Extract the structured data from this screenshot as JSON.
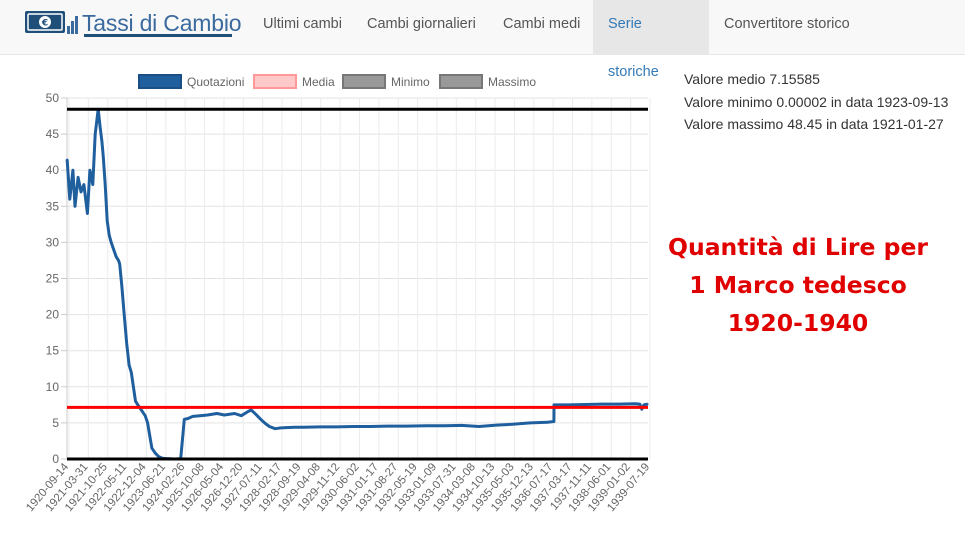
{
  "nav": {
    "brand": "Tassi di Cambio",
    "items": [
      {
        "label": "Ultimi cambi",
        "active": false
      },
      {
        "label": "Cambi giornalieri",
        "active": false
      },
      {
        "label": "Cambi medi",
        "active": false
      },
      {
        "label": "Serie storiche",
        "active": true
      },
      {
        "label": "Convertitore storico",
        "active": false
      }
    ]
  },
  "stats": {
    "avg": "Valore medio 7.15585",
    "min": "Valore minimo 0.00002 in data 1923-09-13",
    "max": "Valore massimo 48.45 in data 1921-01-27"
  },
  "caption": {
    "line1": "Quantità di Lire per",
    "line2": "1 Marco tedesco",
    "line3": "1920-1940"
  },
  "colors": {
    "series": "#1f5f9e",
    "mean": "#ff0000",
    "extreme": "#000000",
    "accent": "#337ab7"
  },
  "chart_data": {
    "type": "line",
    "title": "",
    "xlabel": "",
    "ylabel": "",
    "ylim": [
      0,
      50
    ],
    "yticks": [
      0,
      5,
      10,
      15,
      20,
      25,
      30,
      35,
      40,
      45,
      50
    ],
    "grid": true,
    "legend_position": "top",
    "legend": [
      {
        "name": "Quotazioni",
        "fill": "#1f5f9e",
        "stroke": "#1a4e85"
      },
      {
        "name": "Media",
        "fill": "#ffc9c9",
        "stroke": "#ff9999"
      },
      {
        "name": "Minimo",
        "fill": "#999999",
        "stroke": "#777777"
      },
      {
        "name": "Massimo",
        "fill": "#999999",
        "stroke": "#777777"
      }
    ],
    "x_labels": [
      "1920-09-14",
      "1921-03-31",
      "1921-10-25",
      "1922-05-11",
      "1922-12-04",
      "1923-06-21",
      "1924-02-26",
      "1925-10-08",
      "1926-05-04",
      "1926-12-20",
      "1927-07-11",
      "1928-02-17",
      "1928-09-19",
      "1929-04-08",
      "1929-11-12",
      "1930-06-02",
      "1931-01-17",
      "1931-08-27",
      "1932-05-19",
      "1933-01-09",
      "1933-07-31",
      "1934-03-08",
      "1934-10-13",
      "1935-05-03",
      "1935-12-13",
      "1936-07-17",
      "1937-03-17",
      "1937-11-11",
      "1938-06-01",
      "1939-01-02",
      "1939-07-19"
    ],
    "series": [
      {
        "name": "Quotazioni",
        "x": [
          "1920-01-02",
          "1920-02-05",
          "1920-03-15",
          "1920-04-10",
          "1920-05-20",
          "1920-06-25",
          "1920-08-01",
          "1920-09-14",
          "1920-10-15",
          "1920-11-20",
          "1920-12-20",
          "1921-01-27",
          "1921-02-20",
          "1921-03-15",
          "1921-03-31",
          "1921-04-25",
          "1921-05-20",
          "1921-06-15",
          "1921-07-10",
          "1921-08-10",
          "1921-09-10",
          "1921-10-10",
          "1921-10-25",
          "1921-11-20",
          "1921-12-20",
          "1922-01-20",
          "1922-02-20",
          "1922-03-20",
          "1922-04-15",
          "1922-05-11",
          "1922-06-10",
          "1922-07-10",
          "1922-08-10",
          "1922-09-10",
          "1922-10-10",
          "1922-11-10",
          "1922-12-04",
          "1923-01-15",
          "1923-03-01",
          "1923-04-15",
          "1923-06-01",
          "1923-06-21",
          "1923-09-13",
          "1923-12-01",
          "1924-01-15",
          "1924-02-26",
          "1924-05-01",
          "1924-08-01",
          "1924-11-01",
          "1925-03-01",
          "1925-06-01",
          "1925-10-08",
          "1926-01-01",
          "1926-03-15",
          "1926-05-04",
          "1926-07-01",
          "1926-09-01",
          "1926-10-20",
          "1926-12-20",
          "1927-03-01",
          "1927-05-01",
          "1927-07-11",
          "1927-11-01",
          "1928-02-17",
          "1928-09-19",
          "1929-04-08",
          "1929-11-12",
          "1930-06-02",
          "1931-01-17",
          "1931-08-27",
          "1932-05-19",
          "1933-01-09",
          "1933-07-31",
          "1934-03-08",
          "1934-10-13",
          "1935-05-03",
          "1935-12-13",
          "1936-07-17",
          "1936-10-05",
          "1936-10-06",
          "1937-03-17",
          "1937-11-11",
          "1938-06-01",
          "1939-01-02",
          "1939-07-19",
          "1939-09-20",
          "1939-10-15",
          "1939-11-10",
          "1939-12-29"
        ],
        "values": [
          41.5,
          36,
          40,
          35,
          39,
          37,
          38,
          34,
          40,
          38,
          45,
          48.45,
          46,
          44,
          42,
          38,
          33,
          31,
          30,
          29,
          28,
          27.5,
          27,
          24,
          20,
          16,
          13,
          12,
          10,
          8,
          7.5,
          7,
          6.5,
          6,
          5,
          3,
          1.5,
          0.8,
          0.3,
          0.1,
          0.05,
          0.05,
          2e-05,
          0.05,
          5.5,
          5.6,
          5.9,
          6,
          6.1,
          6.3,
          6.1,
          6.3,
          6,
          6.5,
          6.8,
          6.2,
          5.5,
          5,
          4.5,
          4.2,
          4.3,
          4.35,
          4.4,
          4.4,
          4.45,
          4.45,
          4.5,
          4.5,
          4.55,
          4.55,
          4.6,
          4.6,
          4.65,
          4.5,
          4.7,
          4.8,
          5,
          5.1,
          5.2,
          7.5,
          7.5,
          7.55,
          7.6,
          7.6,
          7.65,
          7.6,
          6.9,
          7.5,
          7.6
        ]
      }
    ],
    "mean": 7.15585,
    "min": {
      "value": 2e-05,
      "date": "1923-09-13"
    },
    "max": {
      "value": 48.45,
      "date": "1921-01-27"
    },
    "extreme_reference_lines": [
      0,
      48.45
    ]
  }
}
